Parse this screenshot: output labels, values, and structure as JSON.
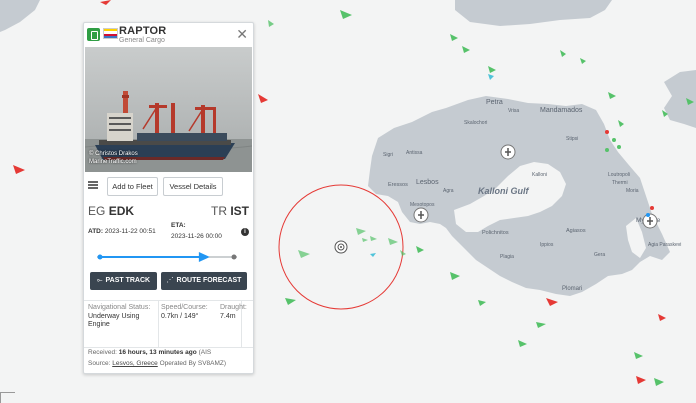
{
  "panel": {
    "ship_name": "RAPTOR",
    "ship_type": "General Cargo",
    "photo_credit_line1": "© Christos Drakos",
    "photo_credit_line2": "MarineTraffic.com",
    "add_fleet_label": "Add to Fleet",
    "vessel_details_label": "Vessel Details",
    "departure_country": "EG",
    "departure_port": "EDK",
    "arrival_country": "TR",
    "arrival_port": "IST",
    "atd_label": "ATD:",
    "atd_value": "2023-11-22 00:51",
    "eta_label": "ETA:",
    "eta_value": "2023-11-26 00:00",
    "voyage_progress": 0.79,
    "past_track_label": "PAST TRACK",
    "route_forecast_label": "ROUTE FORECAST",
    "nav_status_label": "Navigational Status:",
    "nav_status_value": "Underway Using Engine",
    "speed_course_label": "Speed/Course:",
    "speed_course_value": "0.7kn / 149°",
    "draught_label": "Draught:",
    "draught_value": "7.4m",
    "received_label": "Received:",
    "received_value": "16 hours, 13 minutes ago",
    "received_suffix": "(AIS",
    "source_label": "Source:",
    "source_value": "Lesvos, Greece",
    "source_suffix": "Operated By SV8AMZ)"
  },
  "map_labels": {
    "lesbos": "Lesbos",
    "kalloni_gulf": "Kalloni Gulf",
    "mytilene": "Mytilene",
    "petra": "Petra",
    "mandamados": "Mandamados",
    "skalochori": "Skalochori",
    "antissa": "Antissa",
    "eressos": "Eressos",
    "agra": "Agra",
    "mesotopos": "Mesotopos",
    "kalloni": "Kalloni",
    "polichnitos": "Polichnitos",
    "agiasos": "Agiasos",
    "plomari": "Plomari",
    "plagia": "Plagia",
    "gera": "Gera",
    "moria": "Moria",
    "agia_paraskevi": "Agia Paraskevi",
    "loutropoli": "Loutropoli",
    "thermi": "Thermi",
    "stipsi": "Stipsi",
    "sigri": "Sigri",
    "vrisa": "Vrisa",
    "ippios": "Ippios"
  },
  "colors": {
    "sea": "#f3f4f4",
    "land": "#c5cbd1",
    "cargo_vessel": "#56c26a",
    "tanker_vessel": "#e53935",
    "selected_circle": "#e53935",
    "progress_line": "#2196f3",
    "button_dark": "#3a4550"
  }
}
